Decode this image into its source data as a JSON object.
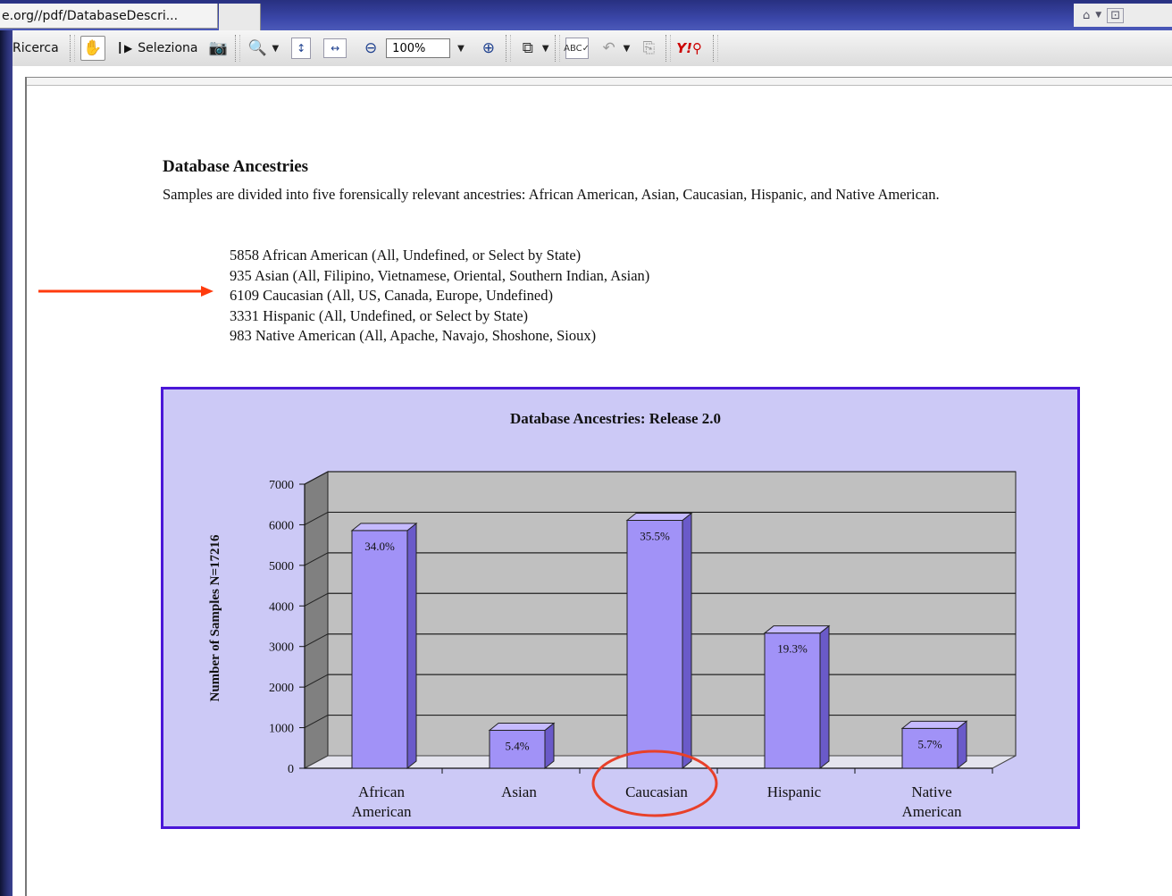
{
  "browser": {
    "tab_title": "e.org//pdf/DatabaseDescri...",
    "topright_icons": [
      "home-icon",
      "rss-icon"
    ]
  },
  "toolbar": {
    "search_label": "Ricerca",
    "select_label": "Seleziona",
    "zoom_value": "100%"
  },
  "document": {
    "heading": "Database Ancestries",
    "paragraph": "Samples are divided into five forensically relevant ancestries: African American, Asian, Caucasian, Hispanic, and Native American.",
    "list": [
      "5858 African American (All, Undefined, or Select by State)",
      "935 Asian (All, Filipino, Vietnamese, Oriental, Southern Indian, Asian)",
      "6109 Caucasian (All, US, Canada, Europe, Undefined)",
      "3331 Hispanic (All, Undefined, or Select by State)",
      "983 Native American (All, Apache, Navajo, Shoshone, Sioux)"
    ]
  },
  "chart_data": {
    "type": "bar",
    "title": "Database Ancestries: Release 2.0",
    "ylabel": "Number of Samples N=17216",
    "xlabel": "",
    "categories": [
      "African American",
      "Asian",
      "Caucasian",
      "Hispanic",
      "Native American"
    ],
    "values": [
      5858,
      935,
      6109,
      3331,
      983
    ],
    "data_labels": [
      "34.0%",
      "5.4%",
      "35.5%",
      "19.3%",
      "5.7%"
    ],
    "yticks": [
      "0",
      "1000",
      "2000",
      "3000",
      "4000",
      "5000",
      "6000",
      "7000"
    ],
    "ylim": [
      0,
      7000
    ],
    "grid": true,
    "style": "3d",
    "colors": {
      "bar": "#a192f7",
      "bar_side": "#6a5ac9",
      "bar_top": "#c5baff",
      "plot_bg": "#c0c0c0",
      "frame_bg": "#ccc9f6",
      "frame_border": "#4a17d8"
    }
  },
  "annotations": {
    "arrow_color": "#ff3b0d",
    "circle_color": "#e8402a",
    "circled_label": "Caucasian"
  }
}
